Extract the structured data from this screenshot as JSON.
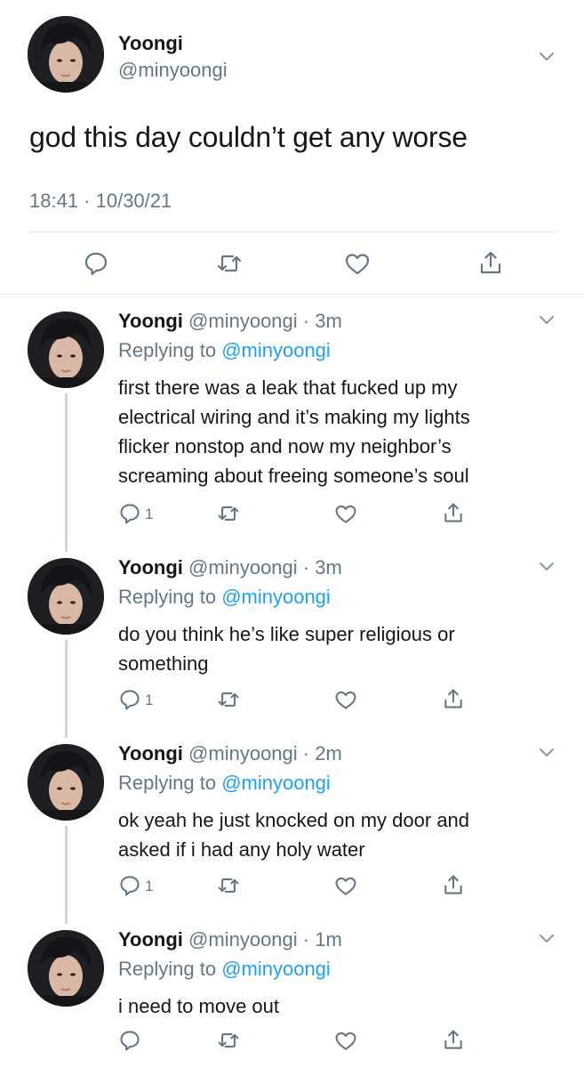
{
  "main_tweet": {
    "display_name": "Yoongi",
    "handle": "@minyoongi",
    "text": "god this day couldn’t get any worse",
    "timestamp": "18:41 · 10/30/21",
    "icons": [
      "reply-icon",
      "retweet-icon",
      "like-icon",
      "share-icon"
    ]
  },
  "replies": [
    {
      "display_name": "Yoongi",
      "handle": "@minyoongi",
      "time": "· 3m",
      "replying_prefix": "Replying to ",
      "replying_to": "@minyoongi",
      "lines": [
        "first there was a leak that fucked up my",
        "electrical wiring and it’s making my lights",
        "flicker nonstop and now my neighbor’s",
        "screaming about freeing someone’s soul"
      ],
      "reply_count": "1"
    },
    {
      "display_name": "Yoongi",
      "handle": "@minyoongi",
      "time": "· 3m",
      "replying_prefix": "Replying to ",
      "replying_to": "@minyoongi",
      "lines": [
        "do you think he’s like super religious or",
        "something"
      ],
      "reply_count": "1"
    },
    {
      "display_name": "Yoongi",
      "handle": "@minyoongi",
      "time": "· 2m",
      "replying_prefix": "Replying to ",
      "replying_to": "@minyoongi",
      "lines": [
        "ok yeah he just knocked on my door and",
        "asked if i had any holy water"
      ],
      "reply_count": "1"
    },
    {
      "display_name": "Yoongi",
      "handle": "@minyoongi",
      "time": "· 1m",
      "replying_prefix": "Replying to ",
      "replying_to": "@minyoongi",
      "lines": [
        "i need to move out"
      ],
      "reply_count": ""
    }
  ],
  "colors": {
    "text": "#14171a",
    "secondary": "#657786",
    "link": "#1da1f2",
    "divider": "#e1e8ed",
    "thread_line": "#ccd6dd"
  }
}
